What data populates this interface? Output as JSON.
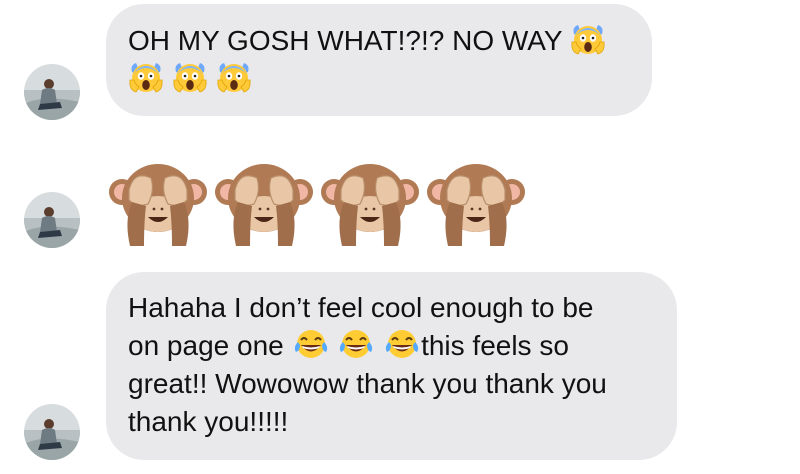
{
  "conversation": {
    "messages": [
      {
        "type": "text",
        "lines": [
          "OH MY GOSH WHAT!?!? NO WAY"
        ],
        "emojis": [
          "screaming-face",
          "screaming-face",
          "screaming-face",
          "screaming-face"
        ]
      },
      {
        "type": "emoji",
        "emojis": [
          "see-no-evil-monkey",
          "see-no-evil-monkey",
          "see-no-evil-monkey",
          "see-no-evil-monkey"
        ]
      },
      {
        "type": "text",
        "line1": "Hahaha I don’t feel cool enough to be",
        "line2_before": "on page one",
        "line2_after": "this feels so",
        "line3": "great!! Wowowow thank you thank you",
        "line4": "thank you!!!!!",
        "emojis": [
          "tears-of-joy",
          "tears-of-joy",
          "tears-of-joy"
        ]
      }
    ]
  },
  "colors": {
    "bubble": "#e9e9eb",
    "text": "#111111"
  }
}
